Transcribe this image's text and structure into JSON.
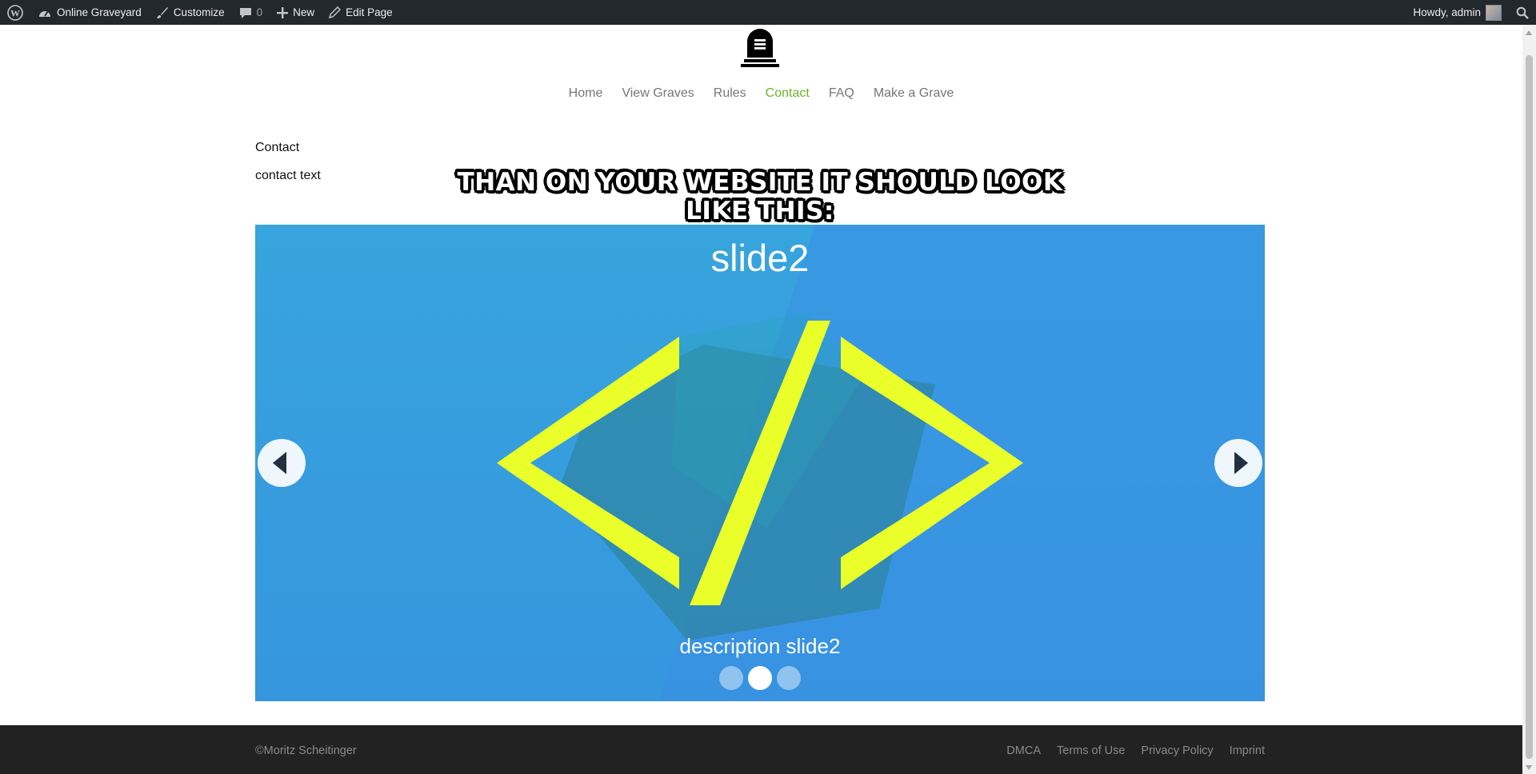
{
  "adminbar": {
    "site_name": "Online Graveyard",
    "customize": "Customize",
    "comments_count": "0",
    "new": "New",
    "edit_page": "Edit Page",
    "greeting": "Howdy, admin"
  },
  "nav": {
    "items": [
      "Home",
      "View Graves",
      "Rules",
      "Contact",
      "FAQ",
      "Make a Grave"
    ],
    "active": "Contact",
    "active_color": "#6ab42d"
  },
  "content": {
    "title": "Contact",
    "text": "contact text"
  },
  "overlay_caption": "Than on your website it should look like this:",
  "slider": {
    "title": "slide2",
    "description": "description slide2",
    "dots": 3,
    "active_dot": 2,
    "accent_color": "#eaff2a",
    "background_color": "#37a4dd"
  },
  "footer": {
    "copyright": "©Moritz Scheitinger",
    "links": [
      "DMCA",
      "Terms of Use",
      "Privacy Policy",
      "Imprint"
    ]
  }
}
